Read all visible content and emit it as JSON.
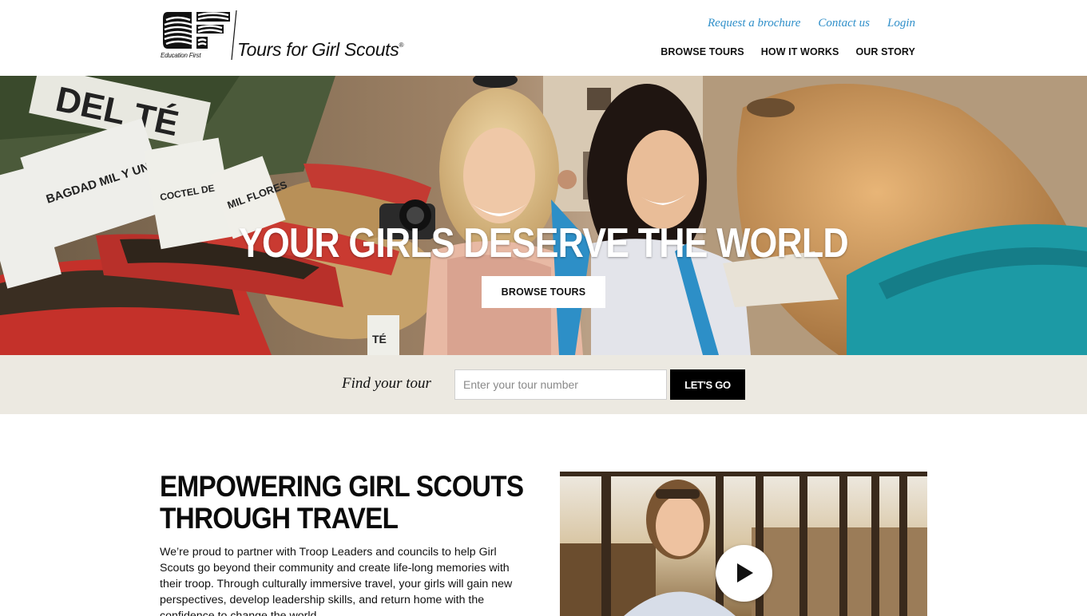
{
  "header": {
    "logo_sub": "Education First",
    "logo_text": "Tours for Girl Scouts",
    "logo_reg": "®",
    "util_nav": [
      "Request a brochure",
      "Contact us",
      "Login"
    ],
    "main_nav": [
      "BROWSE TOURS",
      "HOW IT WORKS",
      "OUR STORY"
    ]
  },
  "hero": {
    "title": "YOUR GIRLS DESERVE THE WORLD",
    "button_label": "BROWSE TOURS",
    "sign_texts": [
      "DEL TÉ",
      "BAGDAD MIL Y UNA NOCHE",
      "COCTEL DEL CARIBE",
      "MIL FLORES",
      "TÉ"
    ]
  },
  "finder": {
    "label": "Find your tour",
    "placeholder": "Enter your tour number",
    "button_label": "LET'S GO"
  },
  "content": {
    "title": "EMPOWERING GIRL SCOUTS THROUGH TRAVEL",
    "body": "We’re proud to partner with Troop Leaders and councils to help Girl Scouts go beyond their community and create life-long memories with their troop. Through culturally immersive travel, your girls will gain new perspectives, develop leadership skills, and return home with the confidence to change the world."
  },
  "colors": {
    "link_blue": "#2f8fc9",
    "finder_bg": "#ece9e1",
    "button_black": "#000000"
  },
  "icons": [
    "ef-logo-icon",
    "play-icon"
  ]
}
